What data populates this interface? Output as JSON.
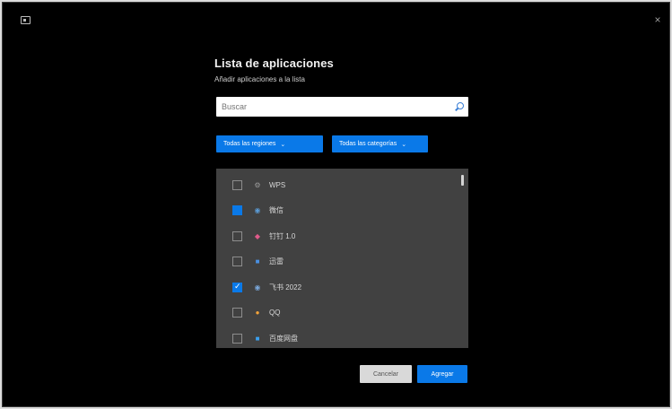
{
  "window": {
    "close_glyph": "×"
  },
  "dialog": {
    "title": "Lista de aplicaciones",
    "subtitle": "Añadir aplicaciones a la lista"
  },
  "search": {
    "value": "Buscar",
    "placeholder": "Buscar"
  },
  "filters": {
    "region_label": "Todas las regiones",
    "category_label": "Todas las categorías"
  },
  "apps": [
    {
      "label": "WPS",
      "checked": false,
      "state": "empty",
      "icon": "settings-app-icon",
      "icon_glyph": "⚙",
      "icon_color": "#9a9a9a"
    },
    {
      "label": "微信",
      "checked": false,
      "state": "filled",
      "icon": "chat-app-icon",
      "icon_glyph": "◉",
      "icon_color": "#5b9bd5"
    },
    {
      "label": "钉钉 1.0",
      "checked": false,
      "state": "empty",
      "icon": "dingtalk-app-icon",
      "icon_glyph": "◆",
      "icon_color": "#e05a8a"
    },
    {
      "label": "迅雷",
      "checked": false,
      "state": "empty",
      "icon": "document-app-icon",
      "icon_glyph": "■",
      "icon_color": "#4a90e2"
    },
    {
      "label": "飞书 2022",
      "checked": true,
      "state": "checked",
      "icon": "cloud-app-icon",
      "icon_glyph": "◉",
      "icon_color": "#7aa7d9"
    },
    {
      "label": "QQ",
      "checked": false,
      "state": "empty",
      "icon": "penguin-app-icon",
      "icon_glyph": "●",
      "icon_color": "#f2a33a"
    },
    {
      "label": "百度网盘",
      "checked": false,
      "state": "empty",
      "icon": "disk-app-icon",
      "icon_glyph": "■",
      "icon_color": "#3aa0ef"
    }
  ],
  "actions": {
    "cancel_label": "Cancelar",
    "add_label": "Agregar"
  },
  "colors": {
    "accent": "#0a79e8",
    "background": "#000000",
    "list_bg": "#414141"
  }
}
